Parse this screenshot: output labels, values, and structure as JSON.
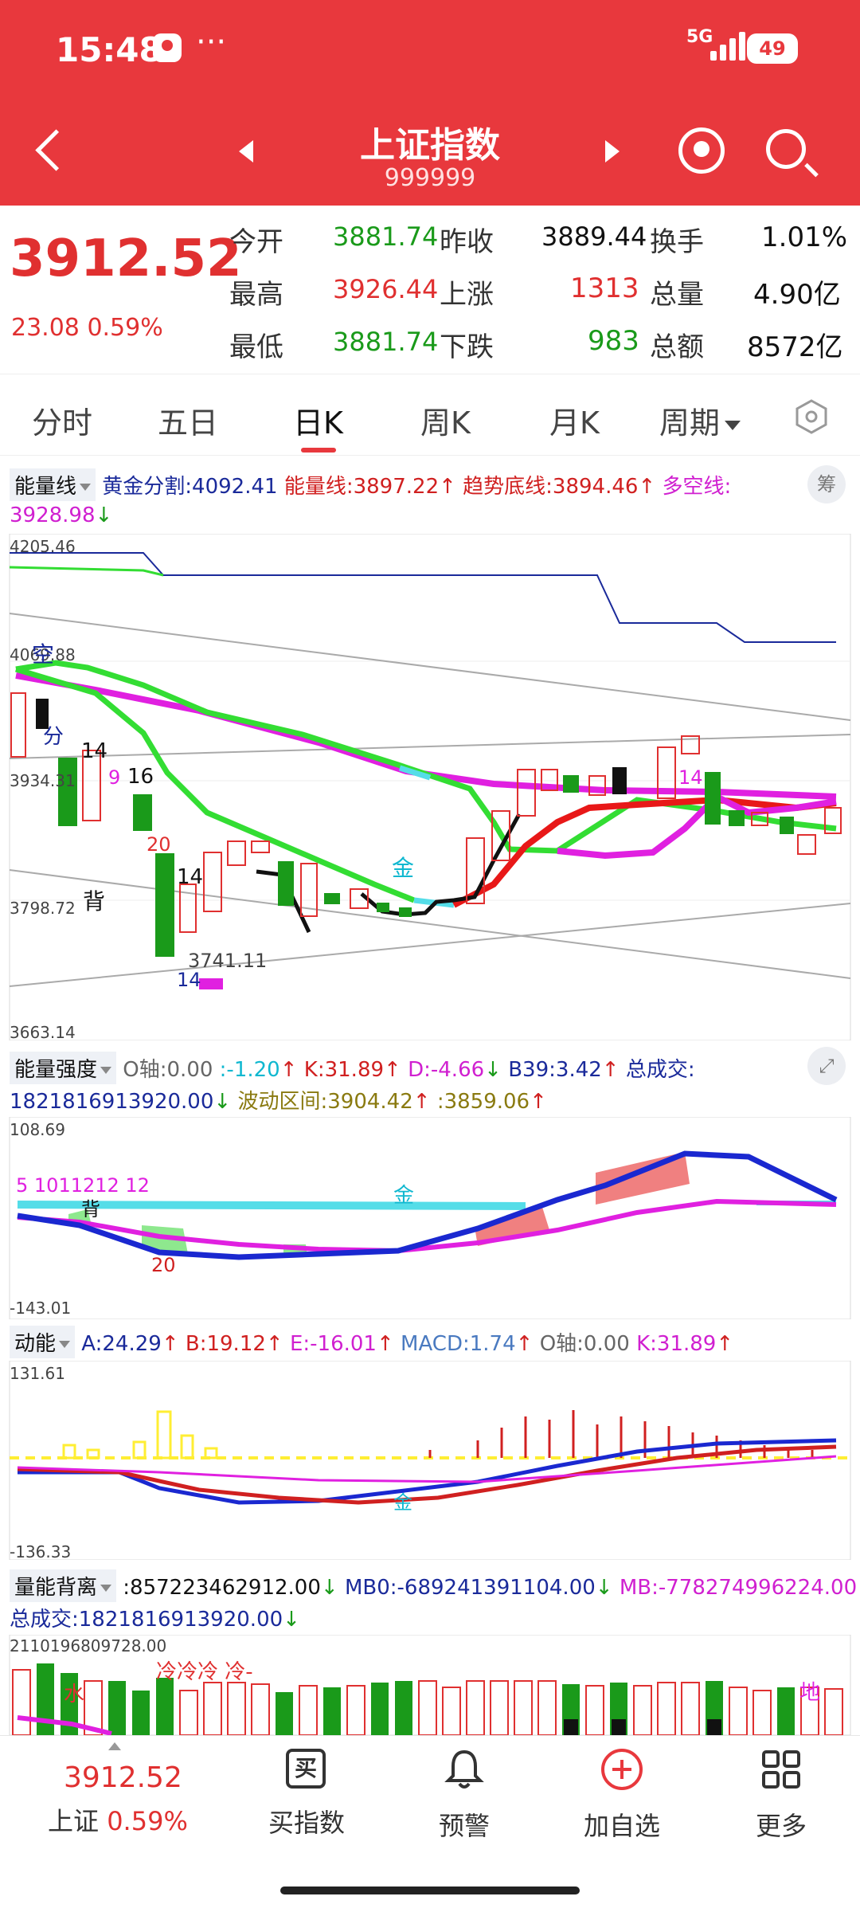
{
  "status_bar": {
    "time": "15:48",
    "more": "···",
    "network": "5G",
    "battery": "49"
  },
  "header": {
    "title": "上证指数",
    "code": "999999"
  },
  "quote": {
    "price": "3912.52",
    "change": "23.08",
    "change_pct": "0.59%",
    "rows": [
      {
        "l1": "今开",
        "v1": "3881.74",
        "l2": "昨收",
        "v2": "3889.44",
        "l3": "换手",
        "v3": "1.01%"
      },
      {
        "l1": "最高",
        "v1": "3926.44",
        "l2": "上涨",
        "v2": "1313",
        "l3": "总量",
        "v3": "4.90亿"
      },
      {
        "l1": "最低",
        "v1": "3881.74",
        "l2": "下跌",
        "v2": "983",
        "l3": "总额",
        "v3": "8572亿"
      }
    ]
  },
  "tabs": [
    "分时",
    "五日",
    "日K",
    "周K",
    "月K",
    "周期"
  ],
  "active_tab": "日K",
  "main_indicator": {
    "selector": "能量线",
    "gold": "黄金分割:4092.41",
    "energy": "能量线:3897.22",
    "trend": "趋势底线:3894.46",
    "longshort_label": "多空线:",
    "longshort_value": "3928.98",
    "side_button": "筹",
    "axis": [
      "4205.46",
      "4069.88",
      "3934.31",
      "3798.72",
      "3663.14"
    ],
    "annotations": {
      "kong": "空",
      "fen": "分",
      "n14a": "14",
      "n9": "9",
      "n16": "16",
      "n20": "20",
      "n14b": "14",
      "bei": "背",
      "low": "3741.11",
      "n14c": "14",
      "jin": "金",
      "n14d": "14"
    }
  },
  "strength": {
    "selector": "能量强度",
    "o_axis": "O轴:0.00",
    "colon_val": ":-1.20",
    "k": "K:31.89",
    "d": "D:-4.66",
    "b39": "B39:3.42",
    "total_label": "总成交:",
    "total_value": "1821816913920.00",
    "range": "波动区间:3904.42",
    "range2": ":3859.06",
    "axis_top": "108.69",
    "axis_bottom": "-143.01",
    "labels": {
      "nums": "5 1011212 12",
      "bei": "背",
      "n20": "20",
      "jin": "金"
    }
  },
  "momentum": {
    "selector": "动能",
    "a": "A:24.29",
    "b": "B:19.12",
    "e": "E:-16.01",
    "macd": "MACD:1.74",
    "o_axis": "O轴:0.00",
    "k": "K:31.89",
    "axis_top": "131.61",
    "axis_bottom": "-136.33",
    "labels": {
      "jin": "金"
    }
  },
  "divergence": {
    "selector": "量能背离",
    "val": ":857223462912.00",
    "mb0": "MB0:-689241391104.00",
    "mb": "MB:-778274996224.00",
    "total": "总成交:1821816913920.00",
    "axis_top": "2110196809728.00",
    "labels": {
      "leng": "冷冷冷 冷-",
      "shui": "水",
      "di": "地"
    }
  },
  "bottom_bar": {
    "price": "3912.52",
    "name": "上证",
    "pct": "0.59%",
    "items": [
      "买指数",
      "预警",
      "加自选",
      "更多"
    ],
    "buy_glyph": "买"
  },
  "colors": {
    "brand_red": "#e8383d",
    "up": "#e03030",
    "down": "#1a9a1a"
  }
}
